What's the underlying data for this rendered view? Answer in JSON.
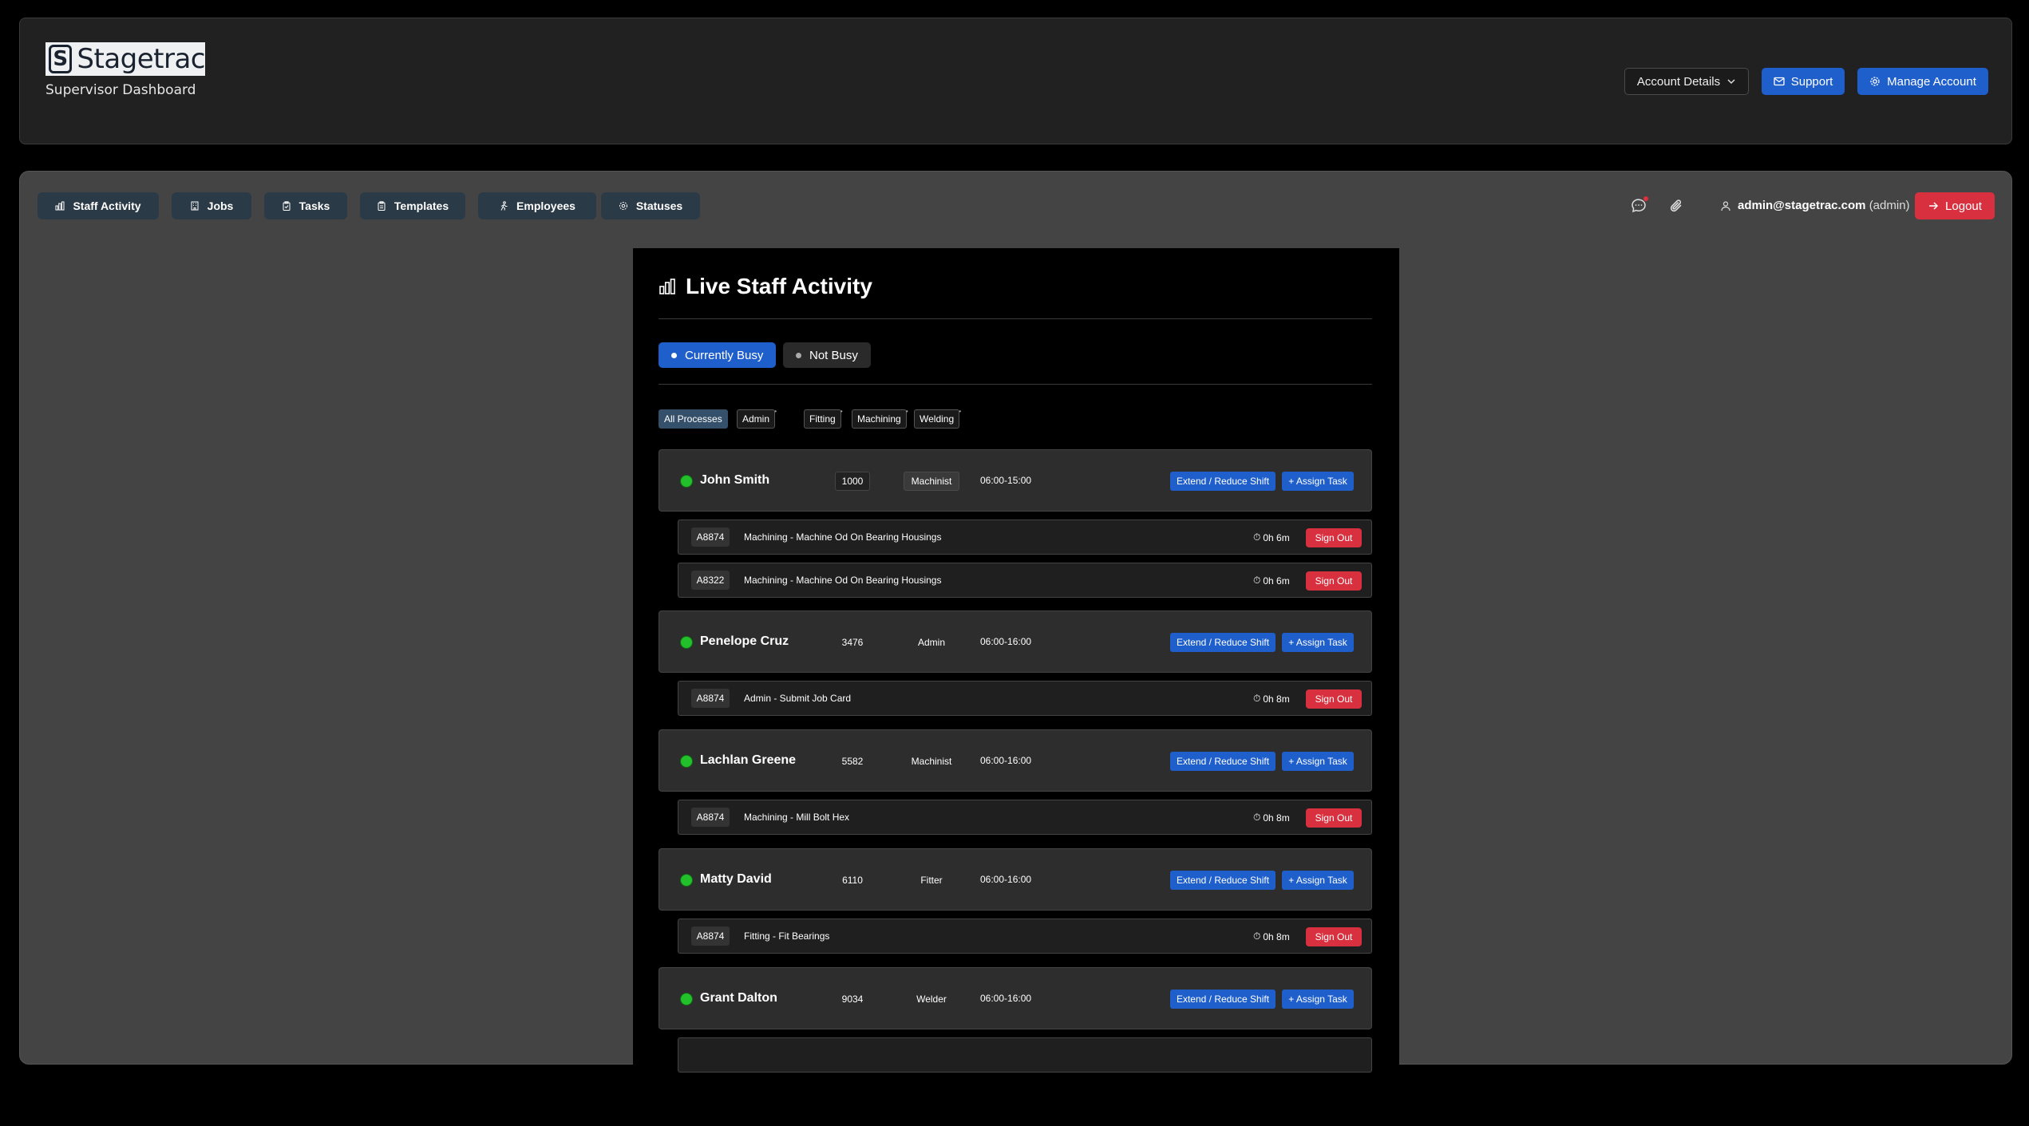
{
  "brand": {
    "logo_letter": "S",
    "logo_text": "Stagetrac",
    "subtitle": "Supervisor Dashboard"
  },
  "header_actions": {
    "account": "Account Details",
    "support": "Support",
    "manage": "Manage Account"
  },
  "tabs": [
    {
      "label": "Staff Activity",
      "icon": "bar-chart-icon"
    },
    {
      "label": "Jobs",
      "icon": "building-icon"
    },
    {
      "label": "Tasks",
      "icon": "clipboard-icon"
    },
    {
      "label": "Templates",
      "icon": "clipboard-icon"
    },
    {
      "label": "Employees",
      "icon": "person-walking-icon"
    },
    {
      "label": "Statuses",
      "icon": "gear-icon"
    }
  ],
  "user": {
    "email": "admin@stagetrac.com",
    "role": "(admin)",
    "logout": "Logout"
  },
  "activity": {
    "title": "Live Staff Activity",
    "filters": {
      "busy": "Currently Busy",
      "not_busy": "Not Busy"
    },
    "processes": [
      "All Processes",
      "Admin",
      "Fitting",
      "Machining",
      "Welding"
    ],
    "action_labels": {
      "extend": "Extend / Reduce Shift",
      "assign": "+ Assign Task",
      "signout": "Sign Out"
    },
    "employees": [
      {
        "name": "John Smith",
        "id": "1000",
        "role": "Machinist",
        "shift": "06:00-15:00"
      },
      {
        "name": "Penelope Cruz",
        "id": "3476",
        "role": "Admin",
        "shift": "06:00-16:00"
      },
      {
        "name": "Lachlan Greene",
        "id": "5582",
        "role": "Machinist",
        "shift": "06:00-16:00"
      },
      {
        "name": "Matty David",
        "id": "6110",
        "role": "Fitter",
        "shift": "06:00-16:00"
      },
      {
        "name": "Grant Dalton",
        "id": "9034",
        "role": "Welder",
        "shift": "06:00-16:00"
      }
    ],
    "tasks": [
      {
        "job": "A8874",
        "desc": "Machining - Machine Od On Bearing Housings",
        "elapsed": "0h 6m"
      },
      {
        "job": "A8322",
        "desc": "Machining - Machine Od On Bearing Housings",
        "elapsed": "0h 6m"
      },
      {
        "job": "A8874",
        "desc": "Admin - Submit Job Card",
        "elapsed": "0h 8m"
      },
      {
        "job": "A8874",
        "desc": "Machining - Mill Bolt Hex",
        "elapsed": "0h 8m"
      },
      {
        "job": "A8874",
        "desc": "Fitting - Fit Bearings",
        "elapsed": "0h 8m"
      }
    ]
  },
  "colors": {
    "primary": "#1f5fcc",
    "danger": "#d9303f",
    "online": "#22c02a",
    "tab_bg": "#2b3a47"
  }
}
